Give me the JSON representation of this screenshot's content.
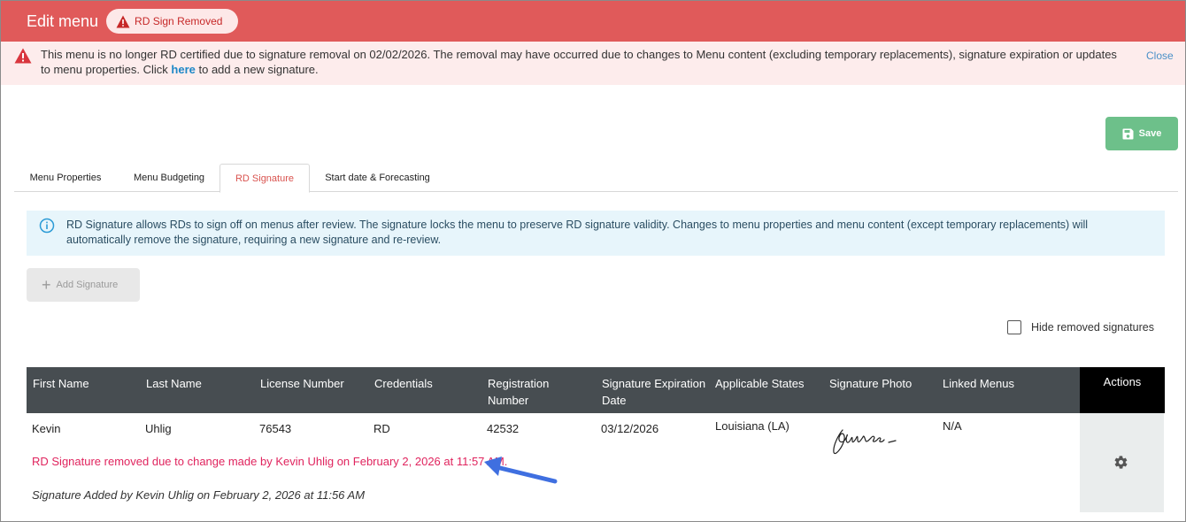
{
  "header": {
    "title": "Edit menu",
    "badge": {
      "label": "RD Sign Removed",
      "icon": "warning-triangle-icon"
    }
  },
  "alert": {
    "message_part1": "This menu is no longer RD certified due to signature removal on 02/02/2026. The removal may have occurred due to changes to Menu content (excluding temporary replacements), signature expiration or updates to menu properties. Click ",
    "link_label": "here",
    "message_part2": " to add a new signature.",
    "close_label": "Close"
  },
  "toolbar": {
    "save_label": "Save"
  },
  "tabs": [
    {
      "label": "Menu Properties"
    },
    {
      "label": "Menu Budgeting"
    },
    {
      "label": "RD Signature",
      "active": true
    },
    {
      "label": "Start date & Forecasting"
    }
  ],
  "info": {
    "text": "RD Signature allows RDs to sign off on menus after review. The signature locks the menu to preserve RD signature validity. Changes to menu properties and menu content (except temporary replacements) will automatically remove the signature, requiring a new signature and re-review."
  },
  "add_signature": {
    "label": "Add Signature",
    "disabled": true
  },
  "hide_removed": {
    "label": "Hide removed signatures",
    "checked": false
  },
  "table": {
    "columns": [
      {
        "label": "First Name"
      },
      {
        "label": "Last Name"
      },
      {
        "label": "License Number"
      },
      {
        "label": "Credentials"
      },
      {
        "label": "Registration Number"
      },
      {
        "label": "Signature Expiration Date"
      },
      {
        "label": "Applicable States"
      },
      {
        "label": "Signature Photo"
      },
      {
        "label": "Linked Menus"
      },
      {
        "label": "Actions"
      }
    ],
    "rows": [
      {
        "first_name": "Kevin",
        "last_name": "Uhlig",
        "license_number": "76543",
        "credentials": "RD",
        "registration_number": "42532",
        "expiration_date": "03/12/2026",
        "applicable_states": "Louisiana (LA)",
        "linked_menus": "N/A",
        "removed_note": "RD Signature removed due to change made by Kevin Uhlig on February 2, 2026 at 11:57 AM.",
        "added_note": "Signature Added by Kevin Uhlig on February 2, 2026 at 11:56 AM"
      }
    ]
  },
  "colors": {
    "header_bg": "#e05a5a",
    "alert_bg": "#fdecec",
    "save_bg": "#6dc08a",
    "info_bg": "#e7f5fb",
    "table_header_bg": "#474d51",
    "removed_text": "#e0245e",
    "arrow": "#3f6fe0"
  }
}
